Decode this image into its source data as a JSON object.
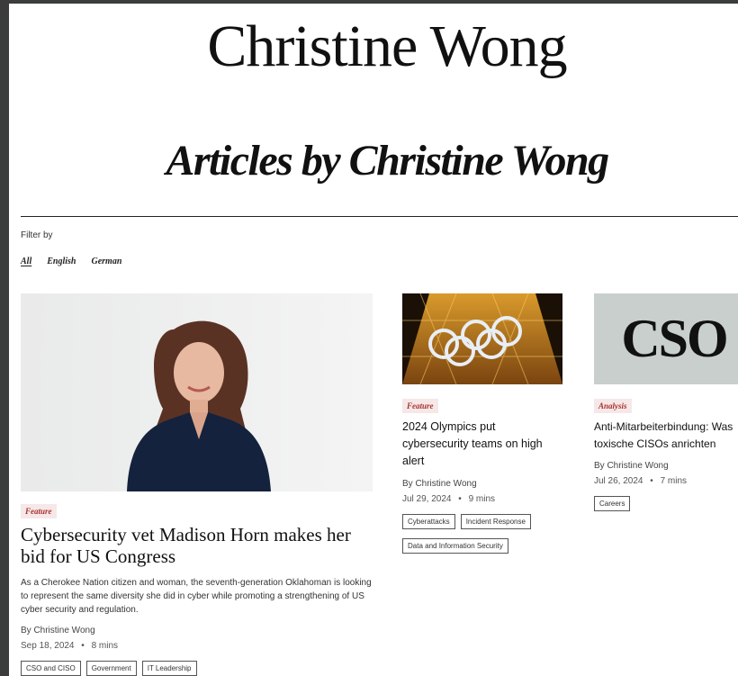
{
  "header": {
    "author_name": "Christine Wong",
    "page_heading": "Articles by Christine Wong"
  },
  "filter": {
    "label": "Filter by",
    "options": [
      {
        "label": "All",
        "active": true
      },
      {
        "label": "English",
        "active": false
      },
      {
        "label": "German",
        "active": false
      }
    ]
  },
  "articles": [
    {
      "tag": "Feature",
      "headline": "Cybersecurity vet Madison Horn makes her bid for US Congress",
      "teaser": "As a Cherokee Nation citizen and woman, the seventh-generation Oklahoman is looking to represent the same diversity she did in cyber while promoting a strengthening of US cyber security and regulation.",
      "byline": "By Christine Wong",
      "date": "Sep 18, 2024",
      "read_time": "8 mins",
      "topics": [
        "CSO and CISO",
        "Government",
        "IT Leadership"
      ]
    },
    {
      "tag": "Feature",
      "headline": "2024 Olympics put cybersecurity teams on high alert",
      "byline": "By Christine Wong",
      "date": "Jul 29, 2024",
      "read_time": "9 mins",
      "topics": [
        "Cyberattacks",
        "Incident Response",
        "Data and Information Security"
      ]
    },
    {
      "tag": "Analysis",
      "headline": "Anti-Mitarbeiterbindung: Was toxische CISOs anrichten",
      "image_text": "CSO",
      "byline": "By Christine Wong",
      "date": "Jul 26, 2024",
      "read_time": "7 mins",
      "topics": [
        "Careers"
      ]
    }
  ],
  "separator": "•",
  "colors": {
    "tag_text": "#a8322d",
    "tag_bg": "#f6e8e8",
    "cso_tile_bg": "#c8cfcc"
  }
}
